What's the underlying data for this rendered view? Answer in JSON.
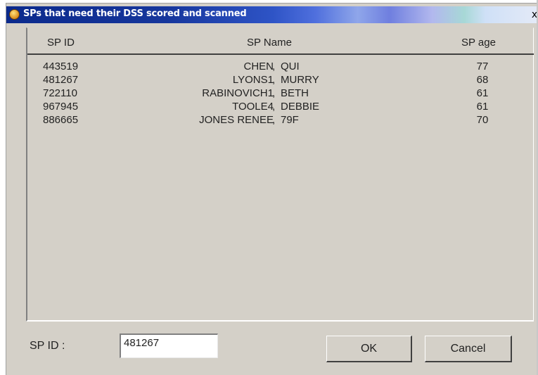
{
  "window": {
    "title": "SPs that need their DSS scored and scanned",
    "close_label": "x"
  },
  "list": {
    "headers": {
      "id": "SP ID",
      "name": "SP Name",
      "age": "SP age"
    },
    "rows": [
      {
        "id": "443519",
        "last": "CHEN",
        "first": "QUI",
        "age": "77"
      },
      {
        "id": "481267",
        "last": "LYONS1",
        "first": "MURRY",
        "age": "68"
      },
      {
        "id": "722110",
        "last": "RABINOVICH1",
        "first": "BETH",
        "age": "61"
      },
      {
        "id": "967945",
        "last": "TOOLE4",
        "first": "DEBBIE",
        "age": "61"
      },
      {
        "id": "886665",
        "last": "JONES RENEE",
        "first": "79F",
        "age": "70"
      }
    ],
    "separator": ","
  },
  "form": {
    "spid_label": "SP ID :",
    "spid_value": "481267"
  },
  "buttons": {
    "ok": "OK",
    "cancel": "Cancel"
  }
}
